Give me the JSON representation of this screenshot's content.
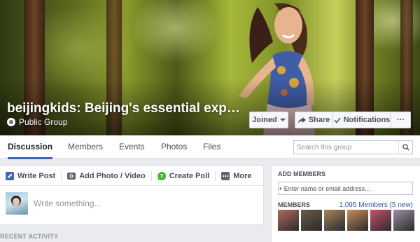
{
  "group": {
    "name": "beijingkids: Beijing's essential exp…",
    "privacy": "Public Group",
    "icon": "globe-icon"
  },
  "cover_actions": {
    "joined_label": "Joined",
    "share_label": "Share",
    "notifications_label": "Notifications",
    "more_label": "···"
  },
  "tabs": [
    {
      "label": "Discussion",
      "active": true
    },
    {
      "label": "Members",
      "active": false
    },
    {
      "label": "Events",
      "active": false
    },
    {
      "label": "Photos",
      "active": false
    },
    {
      "label": "Files",
      "active": false
    }
  ],
  "search": {
    "placeholder": "Search this group",
    "icon": "search-icon"
  },
  "composer": {
    "actions": [
      {
        "label": "Write Post",
        "icon": "pencil-icon",
        "color": "#4267b2"
      },
      {
        "label": "Add Photo / Video",
        "icon": "camera-icon",
        "color": "#606770"
      },
      {
        "label": "Create Poll",
        "icon": "poll-icon",
        "color": "#42b72a"
      },
      {
        "label": "More",
        "icon": "more-icon",
        "color": "#606770"
      }
    ],
    "placeholder": "Write something..."
  },
  "recent_activity_label": "RECENT ACTIVITY",
  "sidebar": {
    "add_members_title": "ADD MEMBERS",
    "add_members_placeholder": "+ Enter name or email address...",
    "members_title": "MEMBERS",
    "members_count": "1,095 Members (5 new)",
    "member_thumbs": [
      {
        "color": "#b06a5c"
      },
      {
        "color": "#6b5a4a"
      },
      {
        "color": "#a9845c"
      },
      {
        "color": "#c98d5a"
      },
      {
        "color": "#c9506a"
      },
      {
        "color": "#9a8fa5"
      }
    ]
  },
  "colors": {
    "accent": "#4267b2",
    "link": "#365899"
  }
}
